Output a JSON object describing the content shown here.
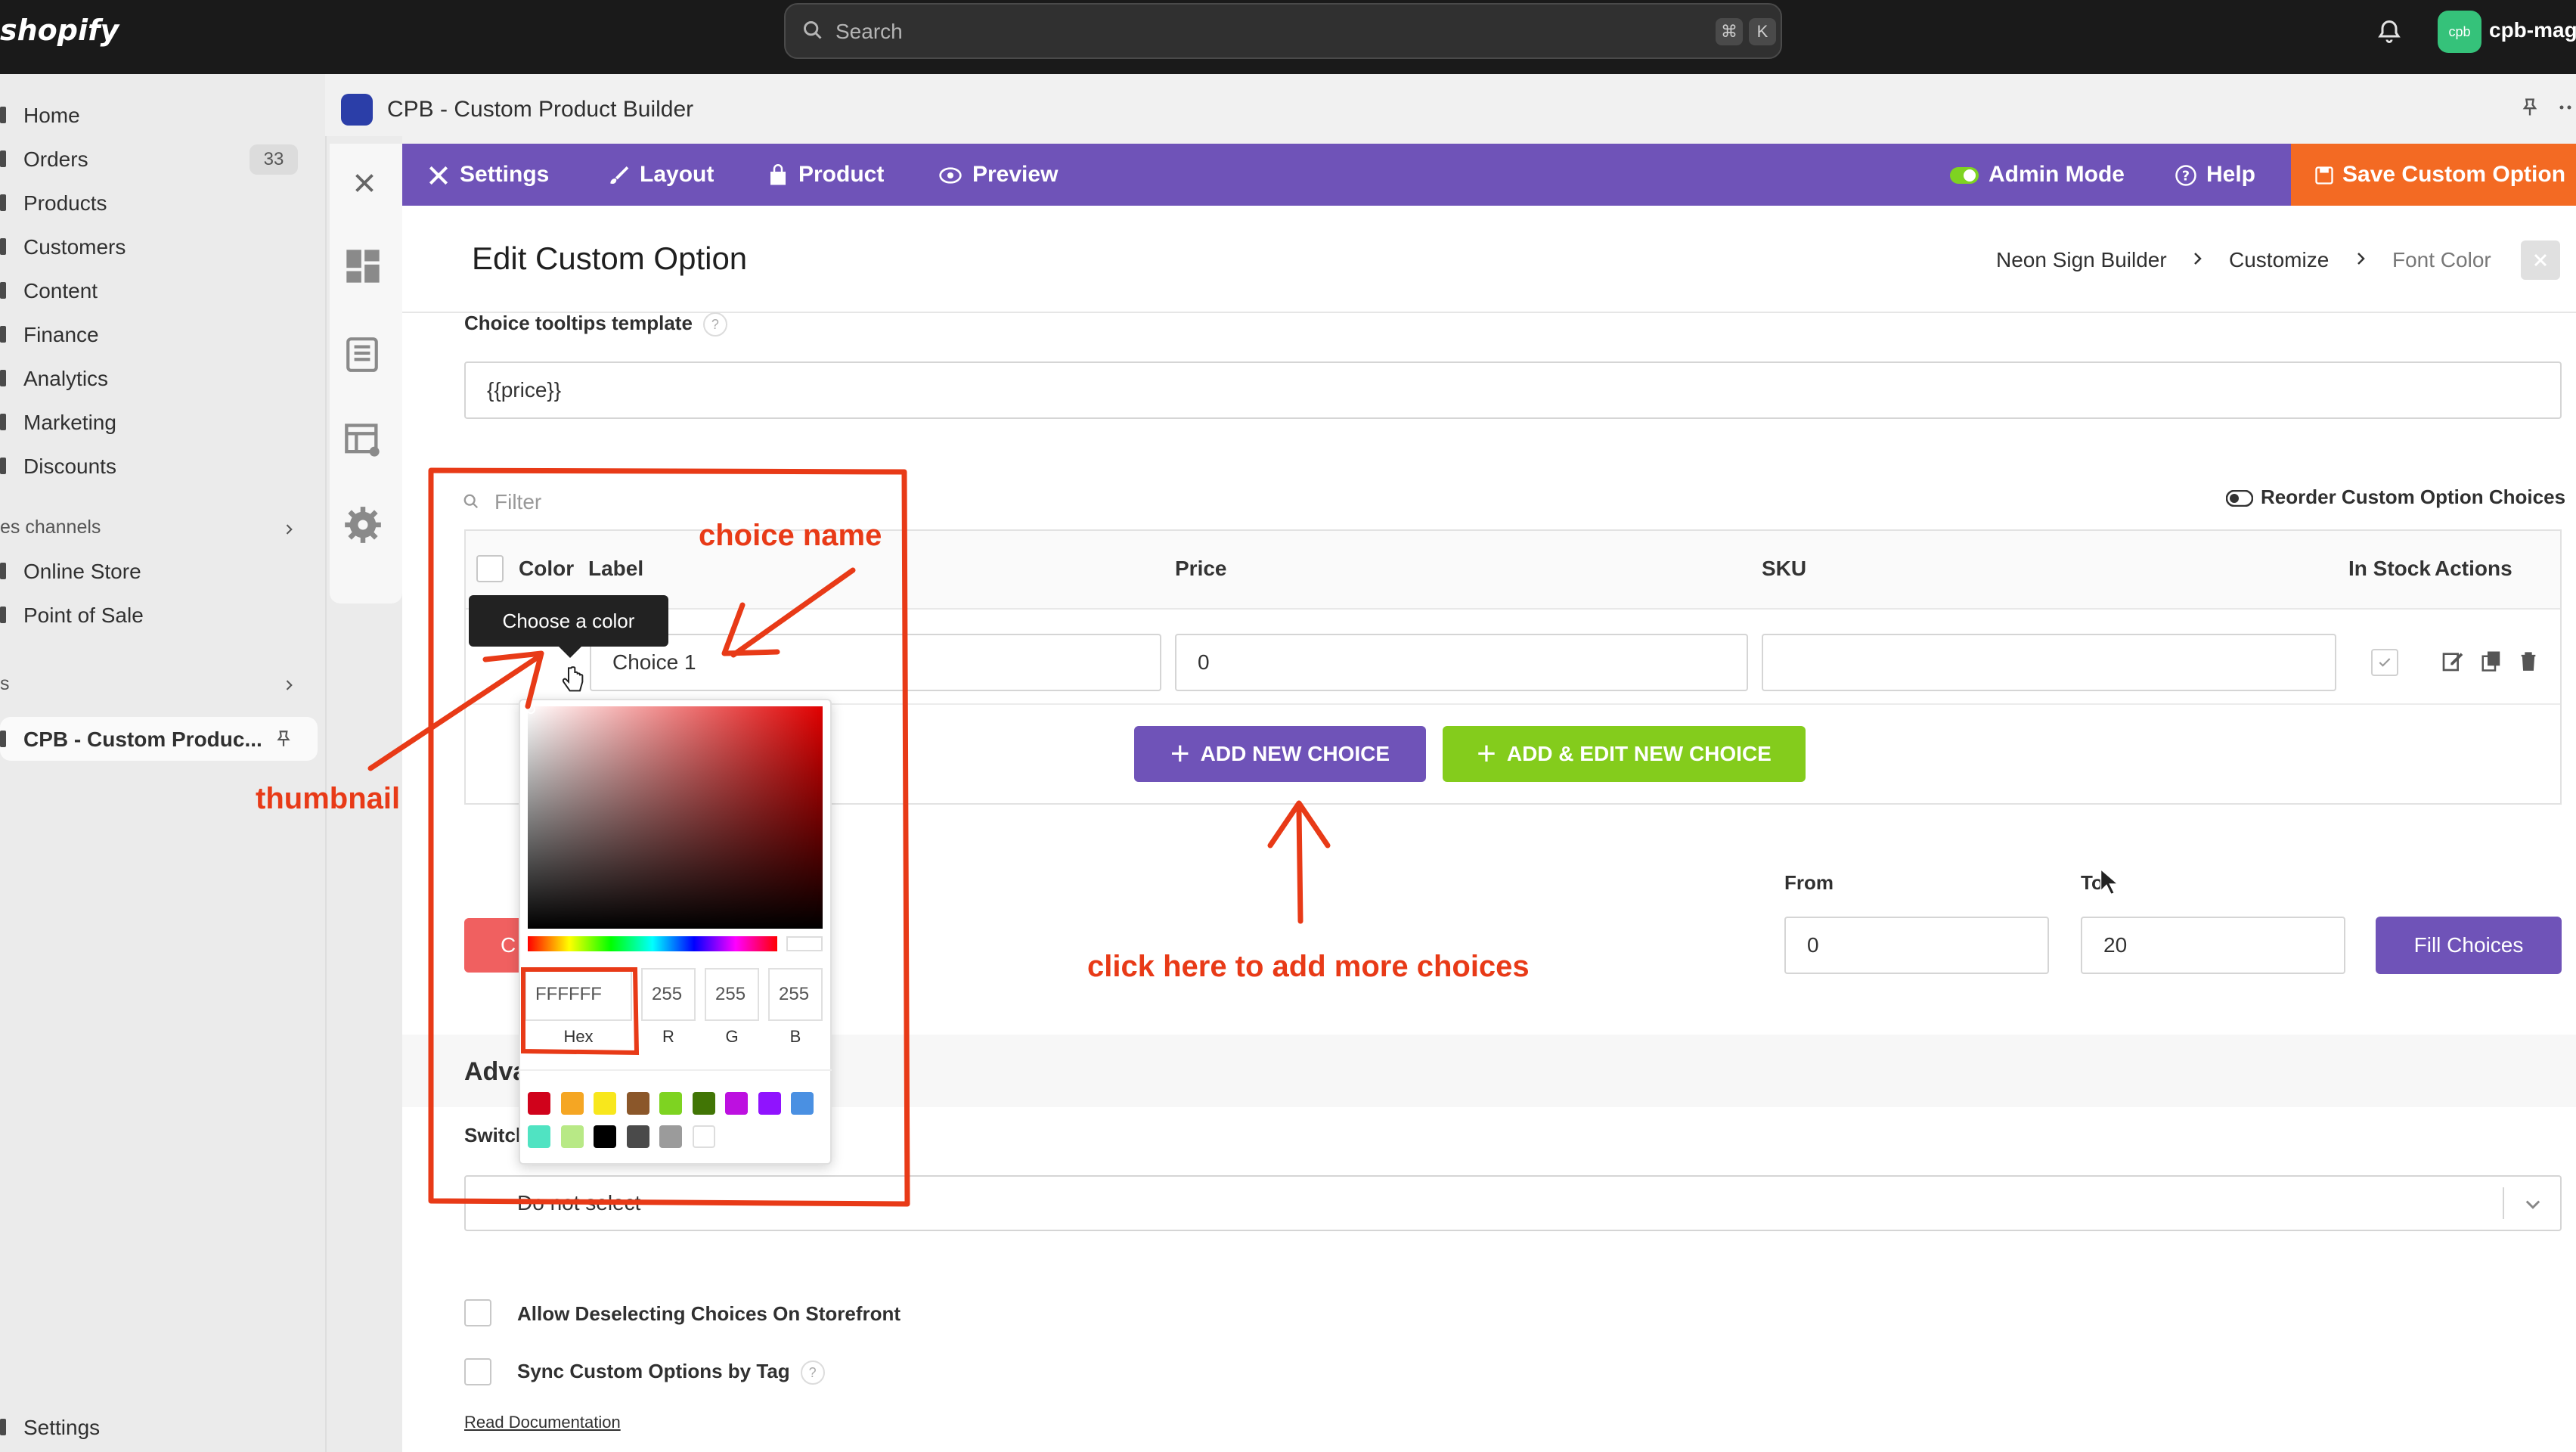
{
  "topbar": {
    "logo": "shopify",
    "search_placeholder": "Search",
    "shortcut_keys": [
      "⌘",
      "K"
    ],
    "avatar_initials": "cpb",
    "store_name": "cpb-mago"
  },
  "sidebar": {
    "items": [
      {
        "label": "Home"
      },
      {
        "label": "Orders",
        "badge": "33"
      },
      {
        "label": "Products"
      },
      {
        "label": "Customers"
      },
      {
        "label": "Content"
      },
      {
        "label": "Finance"
      },
      {
        "label": "Analytics"
      },
      {
        "label": "Marketing"
      },
      {
        "label": "Discounts"
      }
    ],
    "sales_channels_label": "es channels",
    "channels": [
      {
        "label": "Online Store"
      },
      {
        "label": "Point of Sale"
      }
    ],
    "apps_label": "s",
    "active_app": "CPB - Custom Produc...",
    "settings": "Settings"
  },
  "app": {
    "title": "CPB - Custom Product Builder"
  },
  "toolbar": {
    "settings": "Settings",
    "layout": "Layout",
    "product": "Product",
    "preview": "Preview",
    "admin_mode": "Admin Mode",
    "help": "Help",
    "save": "Save Custom Option"
  },
  "page": {
    "title": "Edit Custom Option",
    "breadcrumb": [
      "Neon Sign Builder",
      "Customize",
      "Font Color"
    ]
  },
  "form": {
    "tooltips_template_label": "Choice tooltips template",
    "tooltips_template_value": "{{price}}",
    "filter_placeholder": "Filter",
    "reorder_label": "Reorder Custom Option Choices",
    "columns": [
      "Color",
      "Label",
      "Price",
      "SKU",
      "In Stock",
      "Actions"
    ],
    "row": {
      "label": "Choice 1",
      "price": "0",
      "sku": ""
    },
    "add_choice": "ADD NEW CHOICE",
    "add_edit_choice": "ADD & EDIT NEW CHOICE",
    "from_label": "From",
    "to_label": "To",
    "from_value": "0",
    "to_value": "20",
    "fill_choices": "Fill Choices",
    "partial_red_button": "C",
    "advanced_partial": "Adva",
    "switch_partial": "Switcl",
    "select_placeholder": "Do not select",
    "allow_deselect": "Allow Deselecting Choices On Storefront",
    "sync_by_tag": "Sync Custom Options by Tag",
    "read_docs": "Read Documentation"
  },
  "color_picker": {
    "tooltip": "Choose a color",
    "hex": "FFFFFF",
    "r": "255",
    "g": "255",
    "b": "255",
    "labels": [
      "Hex",
      "R",
      "G",
      "B"
    ],
    "swatches": [
      "#d0021b",
      "#f5a623",
      "#f8e71c",
      "#8b572a",
      "#7ed321",
      "#417505",
      "#bd10e0",
      "#9013fe",
      "#4a90e2",
      "#50e3c2",
      "#b8e986",
      "#000000",
      "#4a4a4a",
      "#9b9b9b",
      "#ffffff"
    ]
  },
  "annotations": {
    "choice_name": "choice name",
    "thumbnail": "thumbnail",
    "add_more": "click here to add more choices"
  },
  "colors": {
    "topbar": "#1a1a1a",
    "toolbar": "#6f53b8",
    "save": "#f36a23",
    "add_green": "#84cc1c",
    "annotation": "#e83a17"
  }
}
